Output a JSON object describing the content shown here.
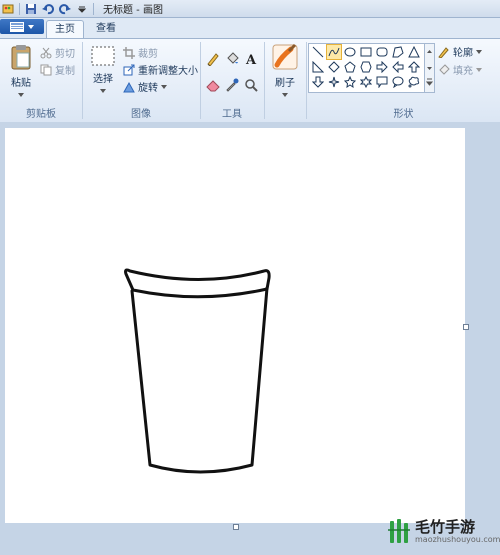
{
  "window": {
    "title": "无标题 - 画图"
  },
  "tabs": {
    "home": "主页",
    "view": "查看"
  },
  "clipboard": {
    "paste": "粘贴",
    "cut": "剪切",
    "copy": "复制",
    "label": "剪贴板"
  },
  "image": {
    "select": "选择",
    "crop": "裁剪",
    "resize": "重新调整大小",
    "rotate": "旋转",
    "label": "图像"
  },
  "tools": {
    "label": "工具"
  },
  "brushes": {
    "label": "刷子"
  },
  "shapes": {
    "outline": "轮廓",
    "fill": "填充",
    "label": "形状"
  },
  "watermark": {
    "name": "毛竹手游",
    "url": "maozhushouyou.com"
  },
  "colors": {
    "accent": "#2e66b8",
    "ribbon": "#f5f9fe",
    "workspace": "#c5d4e6"
  }
}
